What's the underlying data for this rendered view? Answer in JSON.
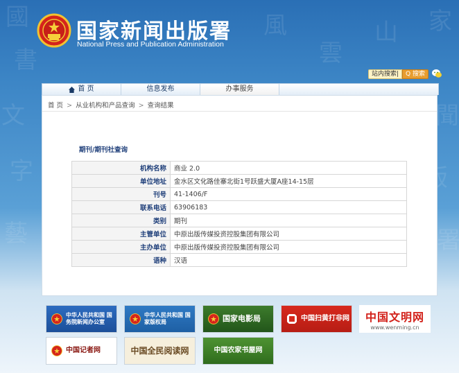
{
  "header": {
    "title": "国家新闻出版署",
    "subtitle": "National  Press and Publication Administration",
    "search_link": "站内搜索|",
    "search_button": "Q  搜索"
  },
  "nav": {
    "items": [
      {
        "label": "首 页",
        "icon": "home-icon"
      },
      {
        "label": "信息发布"
      },
      {
        "label": "办事服务",
        "active": true
      }
    ]
  },
  "breadcrumb": {
    "home": "首 页",
    "sep1": ">",
    "level2": "从业机构和产品查询",
    "sep2": ">",
    "level3": "查询结果"
  },
  "query_title": "期刊/期刊社查询",
  "result": {
    "rows": [
      {
        "label": "机构名称",
        "value": "商业 2.0"
      },
      {
        "label": "单位地址",
        "value": "金水区文化路佳寨北街1号跃盛大厦A座14-15层"
      },
      {
        "label": "刊号",
        "value": "41-1406/F"
      },
      {
        "label": "联系电话",
        "value": "63906183"
      },
      {
        "label": "类别",
        "value": "期刊"
      },
      {
        "label": "主管单位",
        "value": "中原出版传媒投资控股集团有限公司"
      },
      {
        "label": "主办单位",
        "value": "中原出版传媒投资控股集团有限公司"
      },
      {
        "label": "语种",
        "value": "汉语"
      }
    ]
  },
  "partners": {
    "p1": "中华人民共和国 国务院新闻办公室",
    "p2": "中华人民共和国 国家版权局",
    "p3": "国家电影局",
    "p4": "中国扫黄打非网",
    "p5_title": "中国文明网",
    "p5_url": "www.wenming.cn",
    "p6": "中国记者网",
    "p7": "中国全民阅读网",
    "p8": "中国农家书屋网"
  },
  "colors": {
    "brand_blue": "#2a6fb5",
    "label_blue": "#1f3f7a",
    "accent_orange": "#e79d2f",
    "wenming_red": "#d22019"
  }
}
